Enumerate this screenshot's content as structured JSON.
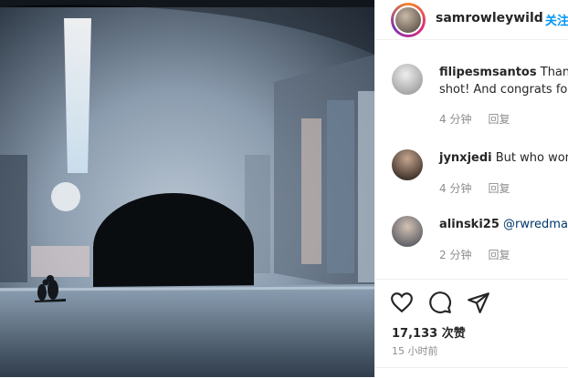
{
  "post": {
    "username": "samrowleywild",
    "follow_label": "关注"
  },
  "comments": [
    {
      "username": "filipesmsantos",
      "text": "Thank",
      "text2": "shot! And congrats fo",
      "time": "4 分钟",
      "reply": "回复"
    },
    {
      "username": "jynxjedi",
      "text": "But who won",
      "time": "4 分钟",
      "reply": "回复"
    },
    {
      "username": "alinski25",
      "mention": "@rwredman",
      "time": "2 分钟",
      "reply": "回复"
    }
  ],
  "actions": {
    "icons": [
      "heart-icon",
      "comment-icon",
      "share-icon"
    ],
    "likes": "17,133 次赞",
    "posted": "15 小时前"
  },
  "colors": {
    "link": "#0095f6",
    "mention": "#00376b",
    "muted": "#8e8e8e"
  }
}
